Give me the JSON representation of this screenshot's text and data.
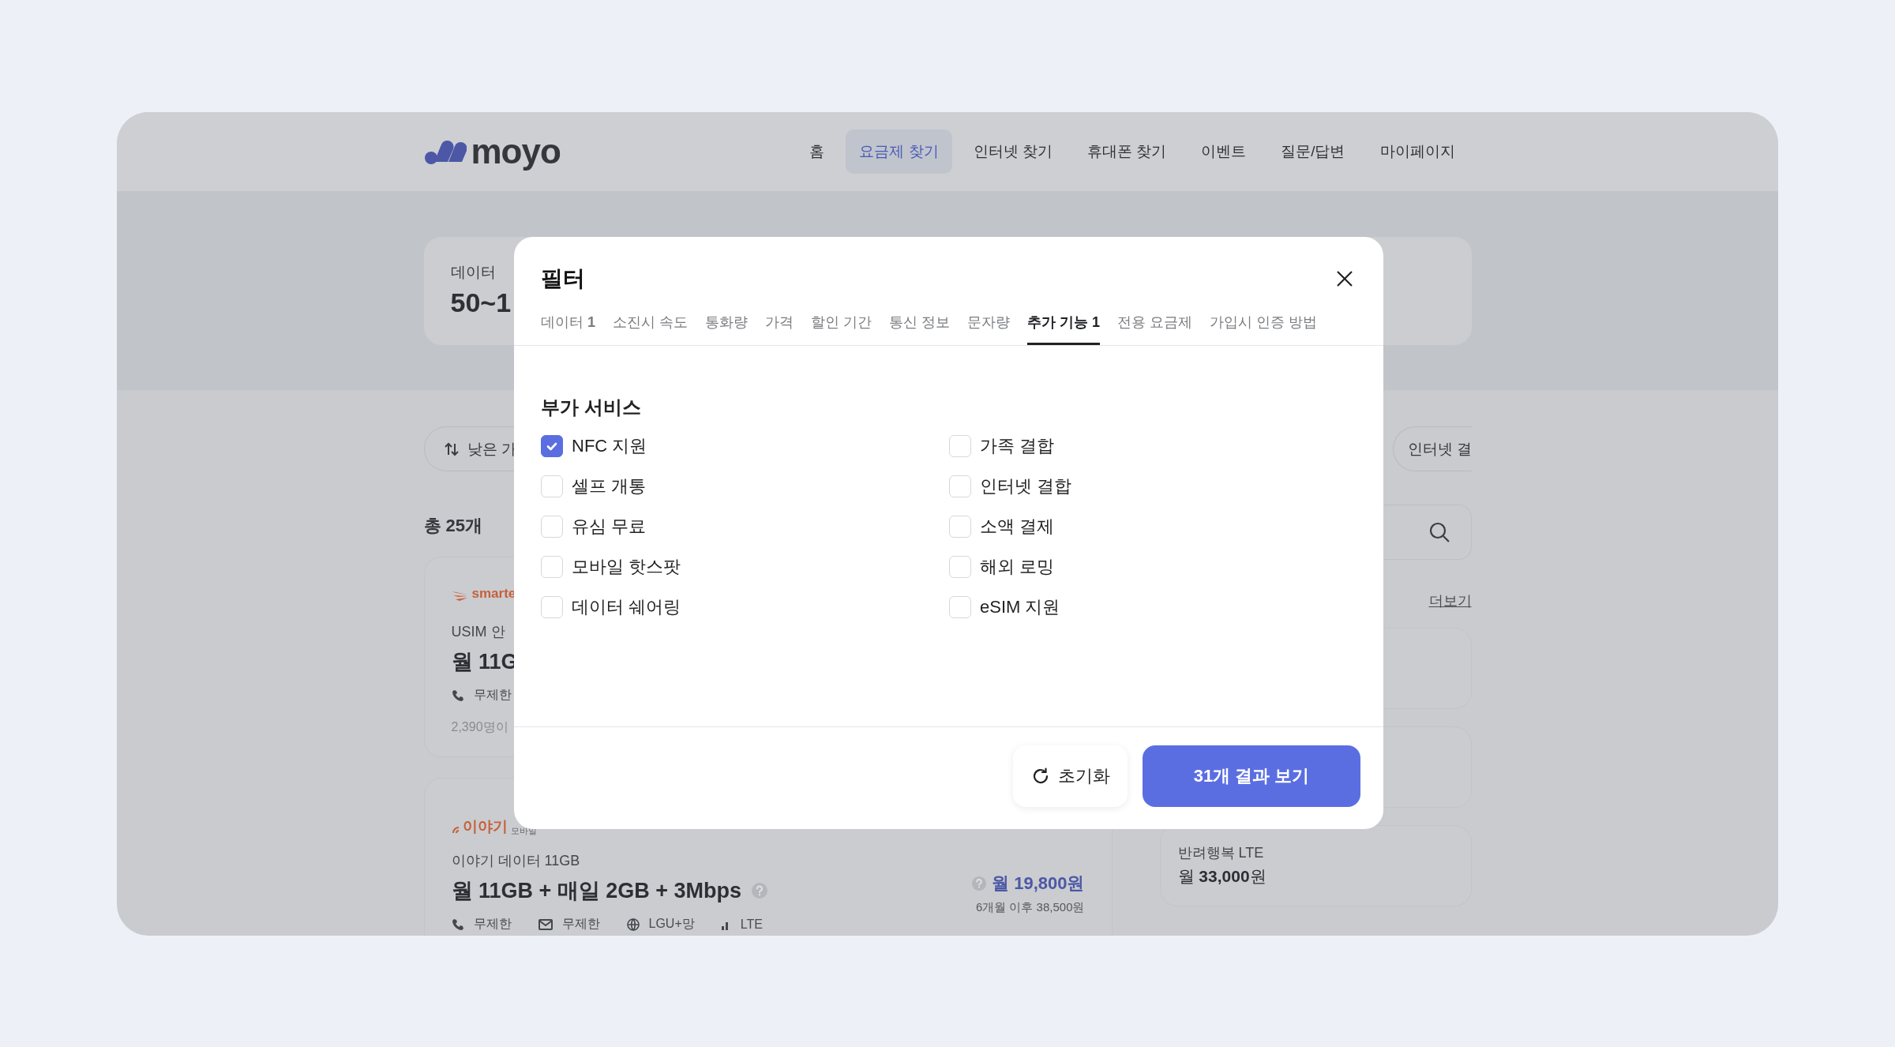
{
  "header": {
    "logo": "moyo",
    "nav": [
      {
        "label": "홈",
        "selected": false
      },
      {
        "label": "요금제 찾기",
        "selected": true
      },
      {
        "label": "인터넷 찾기",
        "selected": false
      },
      {
        "label": "휴대폰 찾기",
        "selected": false
      },
      {
        "label": "이벤트",
        "selected": false
      },
      {
        "label": "질문/답변",
        "selected": false
      },
      {
        "label": "마이페이지",
        "selected": false
      }
    ]
  },
  "hero": {
    "label": "데이터",
    "value": "50~1"
  },
  "toolbar": {
    "sort_chip": "낮은 가",
    "filter_chip": "인터넷 결"
  },
  "total": "총 25개",
  "more_link": "더보기",
  "plans": [
    {
      "kind": "smartel",
      "logo": "smarte",
      "name": "USIM 안",
      "title": "월 11G",
      "specs": [
        {
          "kind": "call",
          "text": "무제한"
        }
      ],
      "footnote": "2,390명이"
    },
    {
      "kind": "iyagi",
      "logo": "이야기",
      "logo_sub": "모바일",
      "name": "이야기 데이터 11GB",
      "title": "월 11GB + 매일 2GB + 3Mbps",
      "price": "월 19,800원",
      "price_note": "6개월 이후 38,500원",
      "specs": [
        {
          "kind": "call",
          "text": "무제한"
        },
        {
          "kind": "sms",
          "text": "무제한"
        },
        {
          "kind": "network",
          "text": "LGU+망"
        },
        {
          "kind": "signal",
          "text": "LTE"
        }
      ]
    }
  ],
  "side_plans": [
    {
      "name": "반려행복 LTE",
      "price": "월 **33,000**원"
    }
  ],
  "modal": {
    "title": "필터",
    "tabs": [
      {
        "label": "데이터 **1**",
        "selected": false
      },
      {
        "label": "소진시 속도",
        "selected": false
      },
      {
        "label": "통화량",
        "selected": false
      },
      {
        "label": "가격",
        "selected": false
      },
      {
        "label": "할인 기간",
        "selected": false
      },
      {
        "label": "통신 정보",
        "selected": false
      },
      {
        "label": "문자량",
        "selected": false
      },
      {
        "label": "추가 기능 1",
        "selected": true
      },
      {
        "label": "전용 요금제",
        "selected": false
      },
      {
        "label": "가입시 인증 방법",
        "selected": false
      }
    ],
    "section_title": "부가 서비스",
    "options": [
      {
        "label": "NFC 지원",
        "checked": true
      },
      {
        "label": "가족 결합",
        "checked": false
      },
      {
        "label": "셀프 개통",
        "checked": false
      },
      {
        "label": "인터넷 결합",
        "checked": false
      },
      {
        "label": "유심 무료",
        "checked": false
      },
      {
        "label": "소액 결제",
        "checked": false
      },
      {
        "label": "모바일 핫스팟",
        "checked": false
      },
      {
        "label": "해외 로밍",
        "checked": false
      },
      {
        "label": "데이터 쉐어링",
        "checked": false
      },
      {
        "label": "eSIM 지원",
        "checked": false
      }
    ],
    "reset_button": "초기화",
    "apply_button": "31개 결과 보기"
  }
}
